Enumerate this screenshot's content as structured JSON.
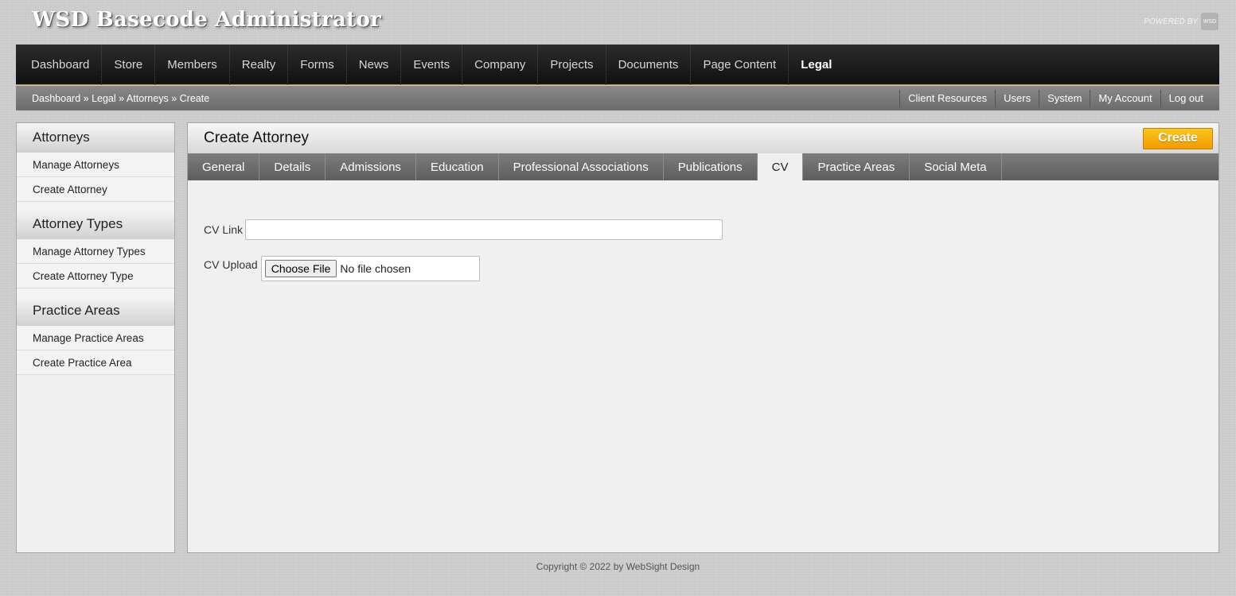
{
  "app": {
    "title": "WSD Basecode Administrator",
    "powered_by": "POWERED BY",
    "powered_logo": "WSD"
  },
  "nav": {
    "items": [
      {
        "label": "Dashboard"
      },
      {
        "label": "Store"
      },
      {
        "label": "Members"
      },
      {
        "label": "Realty"
      },
      {
        "label": "Forms"
      },
      {
        "label": "News"
      },
      {
        "label": "Events"
      },
      {
        "label": "Company"
      },
      {
        "label": "Projects"
      },
      {
        "label": "Documents"
      },
      {
        "label": "Page Content"
      },
      {
        "label": "Legal"
      }
    ],
    "active": "Legal"
  },
  "breadcrumb": {
    "items": [
      "Dashboard",
      "Legal",
      "Attorneys",
      "Create"
    ],
    "separator": "»"
  },
  "util_links": [
    "Client Resources",
    "Users",
    "System",
    "My Account",
    "Log out"
  ],
  "sidebar": {
    "sections": [
      {
        "title": "Attorneys",
        "items": [
          "Manage Attorneys",
          "Create Attorney"
        ]
      },
      {
        "title": "Attorney Types",
        "items": [
          "Manage Attorney Types",
          "Create Attorney Type"
        ]
      },
      {
        "title": "Practice Areas",
        "items": [
          "Manage Practice Areas",
          "Create Practice Area"
        ]
      }
    ]
  },
  "main": {
    "title": "Create Attorney",
    "create_label": "Create",
    "tabs": [
      "General",
      "Details",
      "Admissions",
      "Education",
      "Professional Associations",
      "Publications",
      "CV",
      "Practice Areas",
      "Social Meta"
    ],
    "active_tab": "CV",
    "form": {
      "cv_link_label": "CV Link",
      "cv_link_value": "",
      "cv_upload_label": "CV Upload",
      "choose_file_label": "Choose File",
      "no_file_text": "No file chosen"
    }
  },
  "footer": {
    "copyright": "Copyright © 2022 by WebSight Design"
  },
  "colors": {
    "nav_bg": "#1a1a1a",
    "create_button": "#f7b000",
    "page_bg": "#c9c9c9"
  }
}
